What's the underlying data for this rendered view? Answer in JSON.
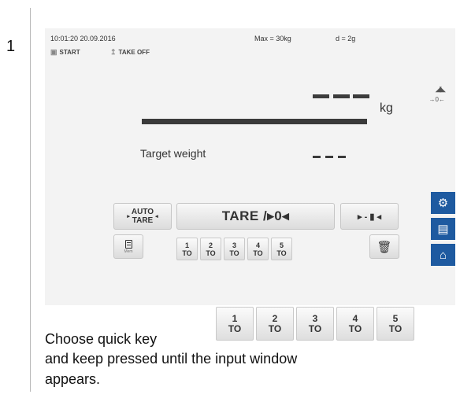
{
  "step": {
    "number": "1"
  },
  "status": {
    "datetime": "10:01:20 20.09.2016",
    "max": "Max = 30kg",
    "division": "d = 2g"
  },
  "top_buttons": {
    "start": "START",
    "takeoff": "TAKE OFF"
  },
  "weight": {
    "unit": "kg",
    "display": "- - -"
  },
  "target": {
    "label": "Target weight",
    "value": "- - -"
  },
  "keys": {
    "auto_tare_line1": "AUTO",
    "auto_tare_line2": "TARE",
    "tare_label": "TARE /▸0◂",
    "arrow_label": "▸ - ▮ ◂",
    "mem_label": "Mem"
  },
  "quick_keys": [
    {
      "num": "1",
      "sub": "TO"
    },
    {
      "num": "2",
      "sub": "TO"
    },
    {
      "num": "3",
      "sub": "TO"
    },
    {
      "num": "4",
      "sub": "TO"
    },
    {
      "num": "5",
      "sub": "TO"
    }
  ],
  "instruction": {
    "line1": "Choose quick key",
    "line2": "and keep pressed until the input window",
    "line3": "appears."
  },
  "icons": {
    "settings": "gear-icon",
    "print": "printer-icon",
    "home": "home-icon",
    "trash": "trash-icon",
    "memory": "memory-icon"
  },
  "colors": {
    "accent": "#1e5aa0",
    "screen_bg": "#f3f3f3",
    "display_dark": "#3a3a3a"
  }
}
